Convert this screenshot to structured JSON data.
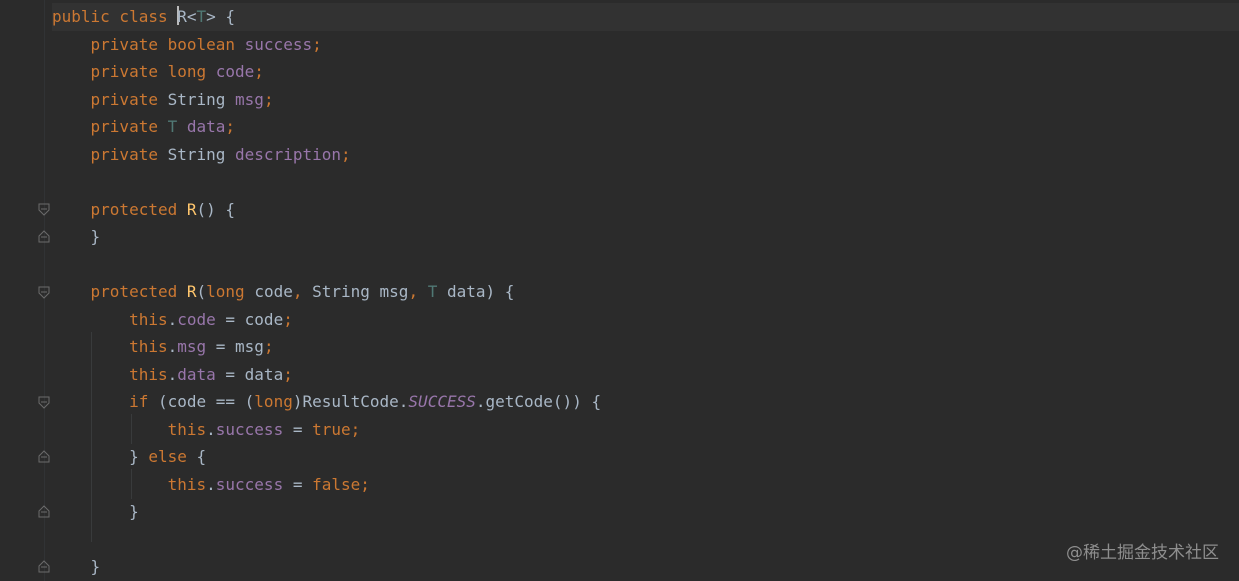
{
  "editor": {
    "lines": [
      [
        {
          "t": "public class ",
          "c": "kw"
        },
        {
          "caret": true
        },
        {
          "t": "R",
          "c": "plain"
        },
        {
          "t": "<",
          "c": "plain"
        },
        {
          "t": "T",
          "c": "tp"
        },
        {
          "t": "> {",
          "c": "plain"
        }
      ],
      [
        {
          "t": "    private boolean ",
          "c": "kw"
        },
        {
          "t": "success",
          "c": "field"
        },
        {
          "t": ";",
          "c": "kw"
        }
      ],
      [
        {
          "t": "    private long ",
          "c": "kw"
        },
        {
          "t": "code",
          "c": "field"
        },
        {
          "t": ";",
          "c": "kw"
        }
      ],
      [
        {
          "t": "    private ",
          "c": "kw"
        },
        {
          "t": "String ",
          "c": "plain"
        },
        {
          "t": "msg",
          "c": "field"
        },
        {
          "t": ";",
          "c": "kw"
        }
      ],
      [
        {
          "t": "    private ",
          "c": "kw"
        },
        {
          "t": "T ",
          "c": "tp"
        },
        {
          "t": "data",
          "c": "field"
        },
        {
          "t": ";",
          "c": "kw"
        }
      ],
      [
        {
          "t": "    private ",
          "c": "kw"
        },
        {
          "t": "String ",
          "c": "plain"
        },
        {
          "t": "description",
          "c": "field"
        },
        {
          "t": ";",
          "c": "kw"
        }
      ],
      [],
      [
        {
          "t": "    protected ",
          "c": "kw"
        },
        {
          "t": "R",
          "c": "fn"
        },
        {
          "t": "() {",
          "c": "plain"
        }
      ],
      [
        {
          "t": "    }",
          "c": "plain"
        }
      ],
      [],
      [
        {
          "t": "    protected ",
          "c": "kw"
        },
        {
          "t": "R",
          "c": "fn"
        },
        {
          "t": "(",
          "c": "plain"
        },
        {
          "t": "long ",
          "c": "kw"
        },
        {
          "t": "code",
          "c": "plain"
        },
        {
          "t": ", ",
          "c": "kw"
        },
        {
          "t": "String msg",
          "c": "plain"
        },
        {
          "t": ", ",
          "c": "kw"
        },
        {
          "t": "T ",
          "c": "tp"
        },
        {
          "t": "data) {",
          "c": "plain"
        }
      ],
      [
        {
          "t": "        this",
          "c": "kw"
        },
        {
          "t": ".",
          "c": "plain"
        },
        {
          "t": "code",
          "c": "field"
        },
        {
          "t": " = code",
          "c": "plain"
        },
        {
          "t": ";",
          "c": "kw"
        }
      ],
      [
        {
          "t": "        this",
          "c": "kw"
        },
        {
          "t": ".",
          "c": "plain"
        },
        {
          "t": "msg",
          "c": "field"
        },
        {
          "t": " = msg",
          "c": "plain"
        },
        {
          "t": ";",
          "c": "kw"
        }
      ],
      [
        {
          "t": "        this",
          "c": "kw"
        },
        {
          "t": ".",
          "c": "plain"
        },
        {
          "t": "data",
          "c": "field"
        },
        {
          "t": " = data",
          "c": "plain"
        },
        {
          "t": ";",
          "c": "kw"
        }
      ],
      [
        {
          "t": "        if ",
          "c": "kw"
        },
        {
          "t": "(code == (",
          "c": "plain"
        },
        {
          "t": "long",
          "c": "kw"
        },
        {
          "t": ")ResultCode.",
          "c": "plain"
        },
        {
          "t": "SUCCESS",
          "c": "static"
        },
        {
          "t": ".getCode()) {",
          "c": "plain"
        }
      ],
      [
        {
          "t": "            this",
          "c": "kw"
        },
        {
          "t": ".",
          "c": "plain"
        },
        {
          "t": "success",
          "c": "field"
        },
        {
          "t": " = ",
          "c": "plain"
        },
        {
          "t": "true;",
          "c": "kw"
        }
      ],
      [
        {
          "t": "        } ",
          "c": "plain"
        },
        {
          "t": "else ",
          "c": "kw"
        },
        {
          "t": "{",
          "c": "plain"
        }
      ],
      [
        {
          "t": "            this",
          "c": "kw"
        },
        {
          "t": ".",
          "c": "plain"
        },
        {
          "t": "success",
          "c": "field"
        },
        {
          "t": " = ",
          "c": "plain"
        },
        {
          "t": "false;",
          "c": "kw"
        }
      ],
      [
        {
          "t": "        }",
          "c": "plain"
        }
      ],
      [],
      [
        {
          "t": "    }",
          "c": "plain"
        }
      ]
    ]
  },
  "watermark": "@稀土掘金技术社区"
}
